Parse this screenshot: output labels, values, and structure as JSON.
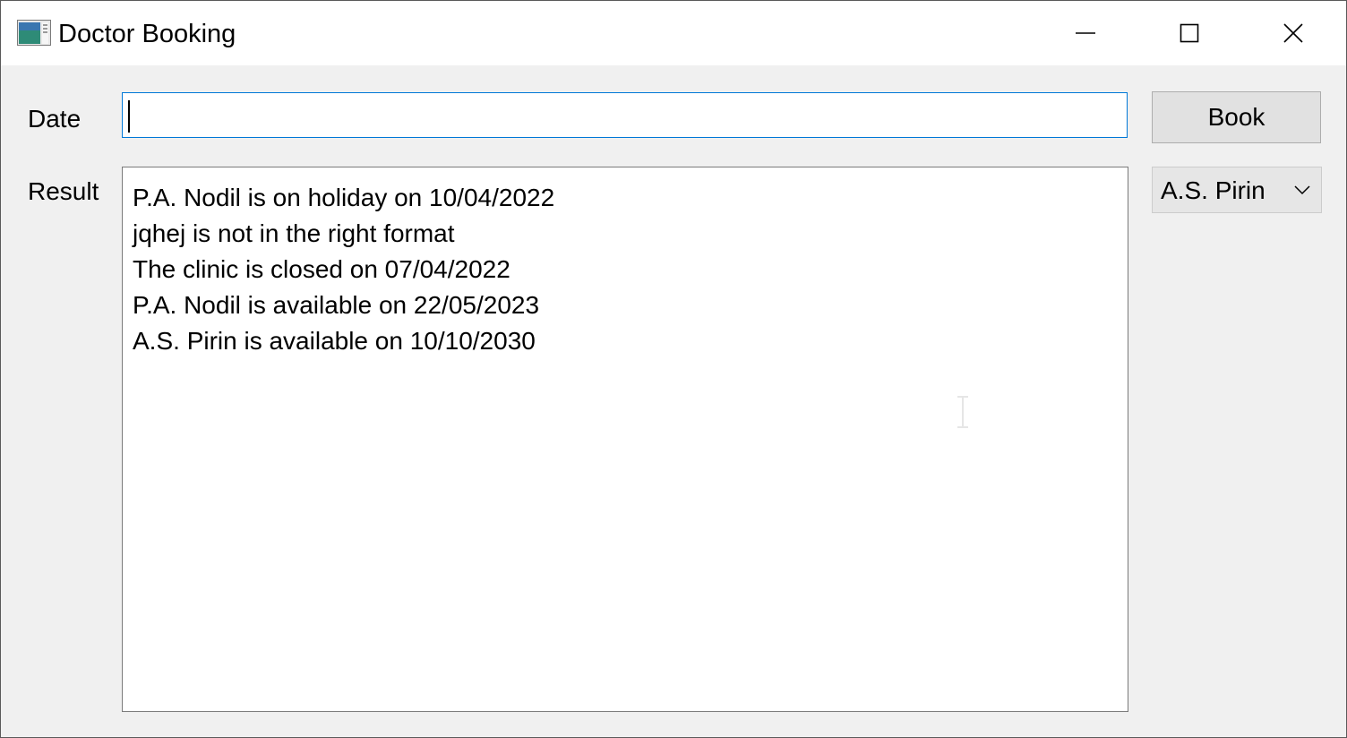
{
  "window": {
    "title": "Doctor Booking",
    "icon": "app-window-icon",
    "controls": {
      "minimize_icon": "minimize-icon",
      "maximize_icon": "maximize-icon",
      "close_icon": "close-icon"
    }
  },
  "form": {
    "date_label": "Date",
    "date_value": "",
    "result_label": "Result",
    "book_label": "Book",
    "doctor_selected": "A.S. Pirin"
  },
  "result": {
    "lines": [
      "P.A. Nodil is on holiday on 10/04/2022",
      "jqhej is not in the right format",
      "The clinic is closed on 07/04/2022",
      "P.A. Nodil is available on 22/05/2023",
      "A.S. Pirin is available on 10/10/2030"
    ]
  },
  "colors": {
    "window_bg": "#f0f0f0",
    "titlebar_bg": "#ffffff",
    "focus_border": "#0078d7",
    "button_bg": "#e1e1e1"
  }
}
